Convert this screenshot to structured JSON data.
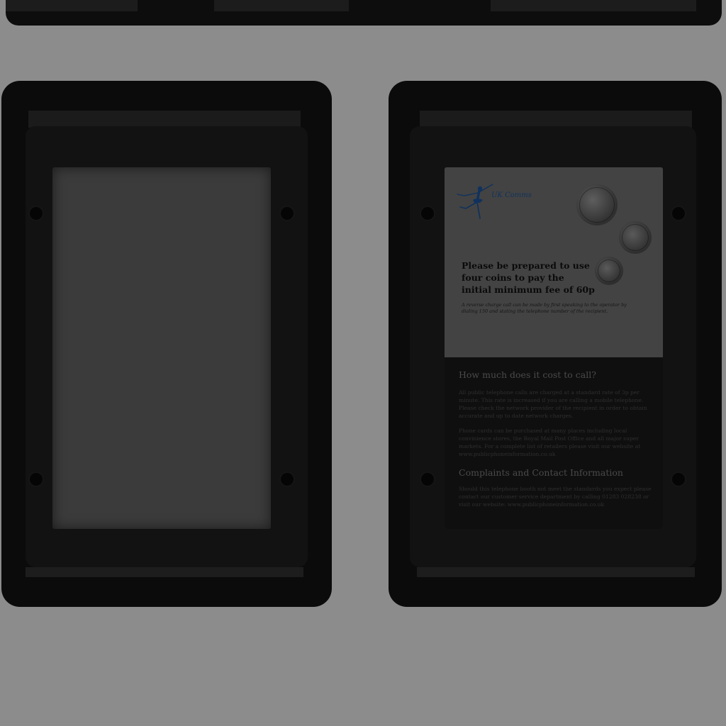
{
  "notice": {
    "brand": "UK Comms",
    "headline": "Please be prepared to use four coins to pay the initial minimum fee of 60p",
    "smallprint": "A reverse charge call can be made by first speaking to the operator by dialing 150 and stating the telephone number of the recipient.",
    "cost_heading": "How much does it cost to call?",
    "cost_para1": "All public telephone calls are charged at a standard rate of 3p per minute. This rate is increased if you are calling a mobile telephone. Please check the network provider of the recipient in order to obtain accurate and up to date network charges.",
    "cost_para2": "Phone cards can be purchased at many places including local convinience stores, the Royal Mail Post Office and all major super markets. For a complete list of retailers please visit our website at www.publicphoneinformation.co.uk",
    "contact_heading": "Complaints and Contact Information",
    "contact_para": "Should this telephone booth not meet the standards you expect please contact our customer service department by calling 01283 028238 or visit our website: www.publicphoneinformation.co.uk"
  },
  "icons": {
    "logo": "ballerina-logo-icon",
    "coins": [
      "fifty-pence-coin-icon",
      "twenty-pence-coin-icon",
      "ten-pence-coin-icon"
    ]
  },
  "colors": {
    "background": "#8c8c8c",
    "frame": "#0b0b0b",
    "brand_blue": "#10325c"
  }
}
